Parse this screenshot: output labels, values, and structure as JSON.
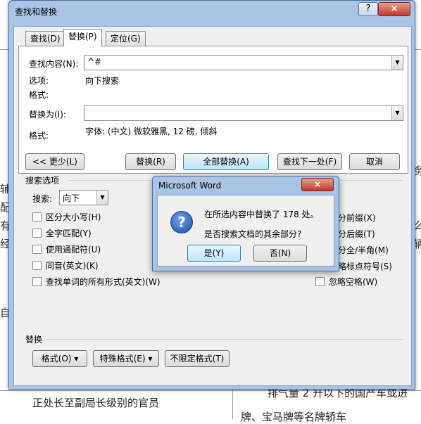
{
  "background": {
    "lines": [
      "正处长至副局长级别的官员",
      "排气量 2 升以下的国产车或进",
      "牌、宝马牌等名牌轿车"
    ],
    "edge_chars": [
      "辅",
      "配",
      "有",
      "经",
      "自",
      "务",
      "么",
      "辆"
    ]
  },
  "dialog": {
    "title": "查找和替换",
    "help": "?",
    "close": "×",
    "tabs": [
      {
        "label": "查找(D)"
      },
      {
        "label": "替换(P)"
      },
      {
        "label": "定位(G)"
      }
    ],
    "find": {
      "label": "查找内容(N):",
      "value": "^#"
    },
    "options_label": "选项:",
    "options_value": "向下搜索",
    "format_label": "格式:",
    "replace": {
      "label": "替换为(I):",
      "value": ""
    },
    "replace_format_label": "格式:",
    "replace_format_value": "字体: (中文) 微软雅黑, 12 磅, 倾斜",
    "buttons": {
      "less": "<< 更少(L)",
      "replace": "替换(R)",
      "replace_all": "全部替换(A)",
      "find_next": "查找下一处(F)",
      "cancel": "取消"
    },
    "search_options_title": "搜索选项",
    "search": {
      "label": "搜索:",
      "value": "向下"
    },
    "checkboxes_left": [
      "区分大小写(H)",
      "全字匹配(Y)",
      "使用通配符(U)",
      "同音(英文)(K)",
      "查找单词的所有形式(英文)(W)"
    ],
    "checkboxes_right_partial": [
      "分前缀(X)",
      "分后缀(T)",
      "分全/半角(M)",
      "略标点符号(S)"
    ],
    "ignore_space": "忽略空格(W)",
    "replace_section_title": "替换",
    "bottom_buttons": {
      "format": "格式(O) ▾",
      "special": "特殊格式(E) ▾",
      "no_format": "不限定格式(T)"
    }
  },
  "message": {
    "title": "Microsoft Word",
    "close": "×",
    "line1": "在所选内容中替换了 178 处。",
    "line2": "是否搜索文档的其余部分?",
    "yes": "是(Y)",
    "no": "否(N)",
    "icon": "?"
  }
}
